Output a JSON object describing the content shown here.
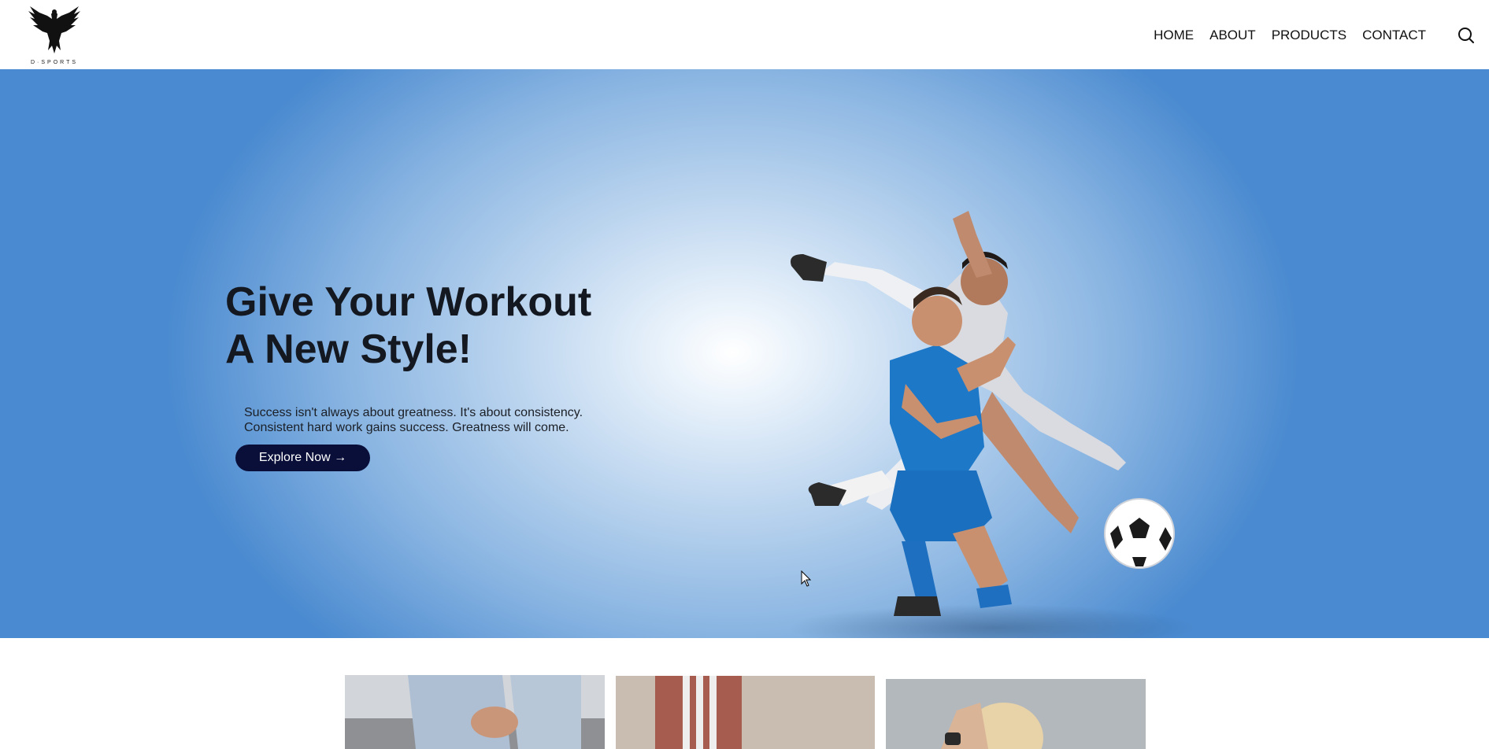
{
  "brand": {
    "name": "D·SPORTS"
  },
  "nav": {
    "items": [
      "HOME",
      "ABOUT",
      "PRODUCTS",
      "CONTACT"
    ],
    "search_icon": "search-icon"
  },
  "hero": {
    "title_line1": "Give Your Workout",
    "title_line2": "A New Style!",
    "text_line1": "Success isn't always about greatness. It's about consistency.",
    "text_line2": "Consistent hard work gains success. Greatness will come.",
    "cta_label": "Explore Now →",
    "colors": {
      "accent": "#0a0f3a",
      "gradient_center": "#ffffff",
      "gradient_edge": "#4a8ad0"
    }
  },
  "products": {
    "cards": [
      "product-card-jeans",
      "product-card-striped-pants",
      "product-card-athlete"
    ]
  }
}
